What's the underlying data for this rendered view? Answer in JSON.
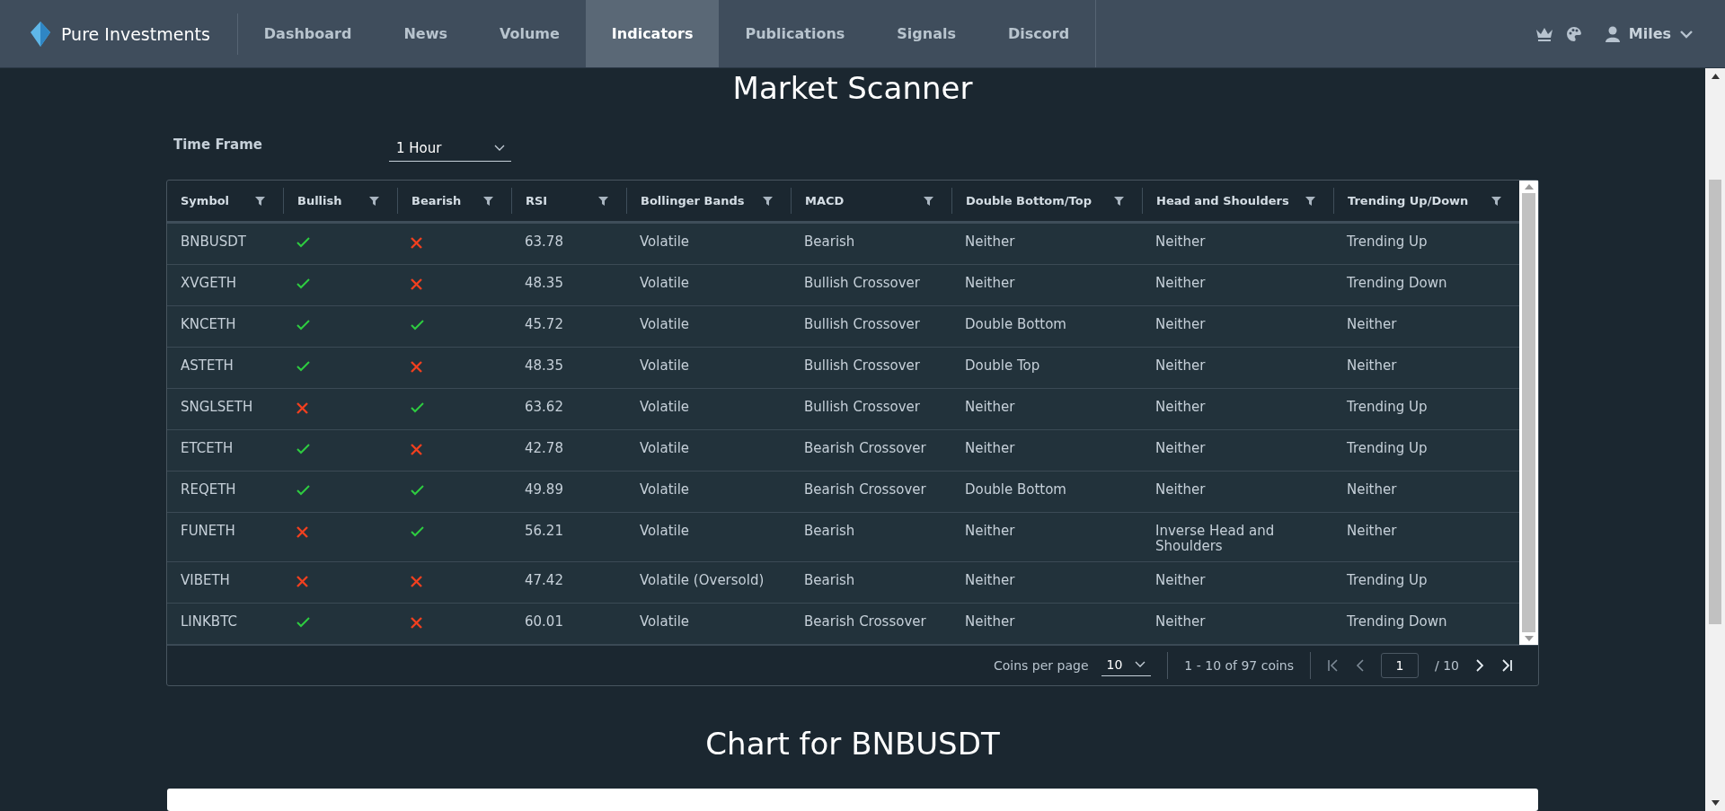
{
  "brand": {
    "name": "Pure Investments"
  },
  "nav": [
    {
      "label": "Dashboard",
      "selected": false
    },
    {
      "label": "News",
      "selected": false
    },
    {
      "label": "Volume",
      "selected": false
    },
    {
      "label": "Indicators",
      "selected": true
    },
    {
      "label": "Publications",
      "selected": false
    },
    {
      "label": "Signals",
      "selected": false
    },
    {
      "label": "Discord",
      "selected": false
    }
  ],
  "user": {
    "name": "Miles"
  },
  "page_title": "Market Scanner",
  "time_frame": {
    "label": "Time Frame",
    "value": "1 Hour"
  },
  "table": {
    "columns": [
      "Symbol",
      "Bullish",
      "Bearish",
      "RSI",
      "Bollinger Bands",
      "MACD",
      "Double Bottom/Top",
      "Head and Shoulders",
      "Trending Up/Down"
    ],
    "rows": [
      {
        "symbol": "BNBUSDT",
        "bullish": true,
        "bearish": false,
        "rsi": "63.78",
        "bollinger": "Volatile",
        "macd": "Bearish",
        "double": "Neither",
        "head_shoulders": "Neither",
        "trending": "Trending Up"
      },
      {
        "symbol": "XVGETH",
        "bullish": true,
        "bearish": false,
        "rsi": "48.35",
        "bollinger": "Volatile",
        "macd": "Bullish Crossover",
        "double": "Neither",
        "head_shoulders": "Neither",
        "trending": "Trending Down"
      },
      {
        "symbol": "KNCETH",
        "bullish": true,
        "bearish": true,
        "rsi": "45.72",
        "bollinger": "Volatile",
        "macd": "Bullish Crossover",
        "double": "Double Bottom",
        "head_shoulders": "Neither",
        "trending": "Neither"
      },
      {
        "symbol": "ASTETH",
        "bullish": true,
        "bearish": false,
        "rsi": "48.35",
        "bollinger": "Volatile",
        "macd": "Bullish Crossover",
        "double": "Double Top",
        "head_shoulders": "Neither",
        "trending": "Neither"
      },
      {
        "symbol": "SNGLSETH",
        "bullish": false,
        "bearish": true,
        "rsi": "63.62",
        "bollinger": "Volatile",
        "macd": "Bullish Crossover",
        "double": "Neither",
        "head_shoulders": "Neither",
        "trending": "Trending Up"
      },
      {
        "symbol": "ETCETH",
        "bullish": true,
        "bearish": false,
        "rsi": "42.78",
        "bollinger": "Volatile",
        "macd": "Bearish Crossover",
        "double": "Neither",
        "head_shoulders": "Neither",
        "trending": "Trending Up"
      },
      {
        "symbol": "REQETH",
        "bullish": true,
        "bearish": true,
        "rsi": "49.89",
        "bollinger": "Volatile",
        "macd": "Bearish Crossover",
        "double": "Double Bottom",
        "head_shoulders": "Neither",
        "trending": "Neither"
      },
      {
        "symbol": "FUNETH",
        "bullish": false,
        "bearish": true,
        "rsi": "56.21",
        "bollinger": "Volatile",
        "macd": "Bearish",
        "double": "Neither",
        "head_shoulders": "Inverse Head and Shoulders",
        "trending": "Neither"
      },
      {
        "symbol": "VIBETH",
        "bullish": false,
        "bearish": false,
        "rsi": "47.42",
        "bollinger": "Volatile (Oversold)",
        "macd": "Bearish",
        "double": "Neither",
        "head_shoulders": "Neither",
        "trending": "Trending Up"
      },
      {
        "symbol": "LINKBTC",
        "bullish": true,
        "bearish": false,
        "rsi": "60.01",
        "bollinger": "Volatile",
        "macd": "Bearish Crossover",
        "double": "Neither",
        "head_shoulders": "Neither",
        "trending": "Trending Down"
      }
    ]
  },
  "pagination": {
    "per_page_label": "Coins per page",
    "per_page": "10",
    "range": "1 - 10 of 97 coins",
    "page": "1",
    "total": "/ 10"
  },
  "chart_title": "Chart for BNBUSDT"
}
